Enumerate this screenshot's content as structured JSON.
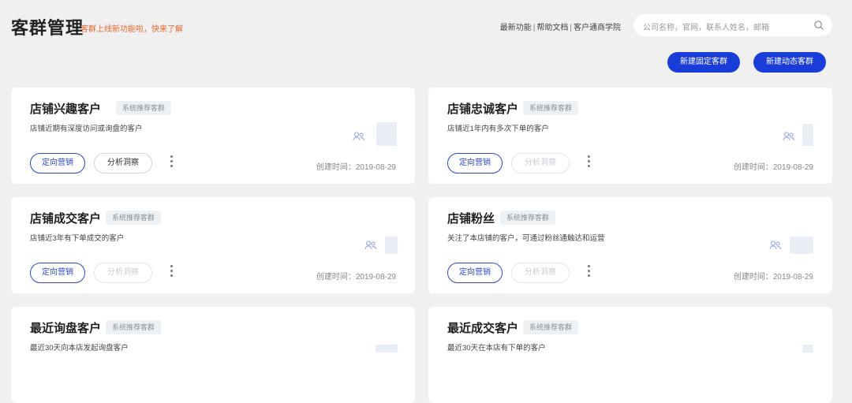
{
  "header": {
    "title": "客群管理",
    "note": "客群上线新功能啦，快来了解",
    "links": [
      "最新功能",
      "帮助文档",
      "客户通商学院"
    ],
    "search_placeholder": "公司名称，官网，联系人姓名，邮箱"
  },
  "actions": {
    "new_fixed": "新建固定客群",
    "new_dynamic": "新建动态客群"
  },
  "cards": [
    {
      "name": "店铺兴趣客户",
      "tag": "系统推荐客群",
      "desc": "店铺近期有深度访问或询盘的客户",
      "btn1": "定向营销",
      "btn2": "分析洞察",
      "btn2_disabled": false,
      "created": "创建时间：2019-08-29"
    },
    {
      "name": "店铺忠诚客户",
      "tag": "系统推荐客群",
      "desc": "店铺近1年内有多次下单的客户",
      "btn1": "定向营销",
      "btn2": "分析洞察",
      "btn2_disabled": true,
      "created": "创建时间：2019-08-29"
    },
    {
      "name": "店铺成交客户",
      "tag": "系统推荐客群",
      "desc": "店铺近3年有下单成交的客户",
      "btn1": "定向营销",
      "btn2": "分析洞察",
      "btn2_disabled": true,
      "created": "创建时间：2019-08-29"
    },
    {
      "name": "店铺粉丝",
      "tag": "系统推荐客群",
      "desc": "关注了本店铺的客户，可通过粉丝通触达和运营",
      "btn1": "定向营销",
      "btn2": "分析洞察",
      "btn2_disabled": true,
      "created": "创建时间：2019-08-29"
    },
    {
      "name": "最近询盘客户",
      "tag": "系统推荐客群",
      "desc": "最近30天向本店发起询盘客户",
      "btn1": "",
      "btn2": "",
      "btn2_disabled": true,
      "created": ""
    },
    {
      "name": "最近成交客户",
      "tag": "系统推荐客群",
      "desc": "最近30天在本店有下单的客户",
      "btn1": "",
      "btn2": "",
      "btn2_disabled": true,
      "created": ""
    }
  ],
  "icons": {
    "search": "search-icon",
    "people": "people-icon",
    "more": "more-vertical-icon"
  },
  "colors": {
    "primary": "#1a3cd8",
    "accent_note": "#e8662b",
    "page_bg": "#f0f0f0"
  }
}
